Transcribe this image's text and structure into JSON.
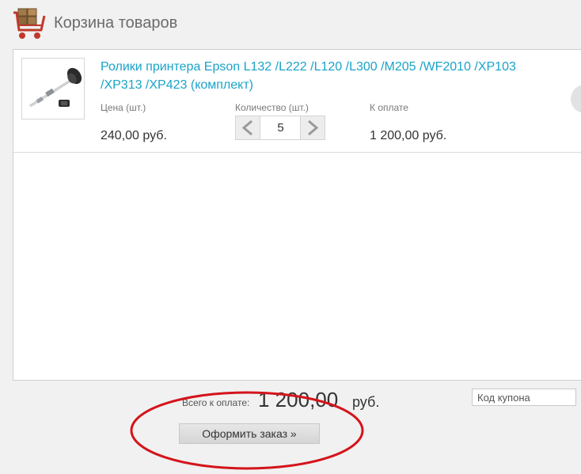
{
  "header": {
    "title": "Корзина товаров",
    "icon": "shopping-cart-boxes-icon"
  },
  "cart": {
    "items": [
      {
        "name": "Ролики принтера Epson L132 /L222 /L120 /L300 /M205 /WF2010 /XP103 /XP313 /XP423 (комплект)",
        "price_label": "Цена (шт.)",
        "price": "240,00 руб.",
        "quantity_label": "Количество (шт.)",
        "quantity": "5",
        "total_label": "К оплате",
        "total": "1 200,00 руб.",
        "thumbnail": "printer-roller-image"
      }
    ]
  },
  "summary": {
    "total_label": "Всего к оплате:",
    "total_value": "1 200,00",
    "currency": "руб.",
    "coupon_placeholder": "Код купона",
    "order_button": "Оформить заказ »"
  },
  "colors": {
    "link": "#1aa3c9",
    "annotation": "#d4141b",
    "background": "#f1f1f1"
  }
}
